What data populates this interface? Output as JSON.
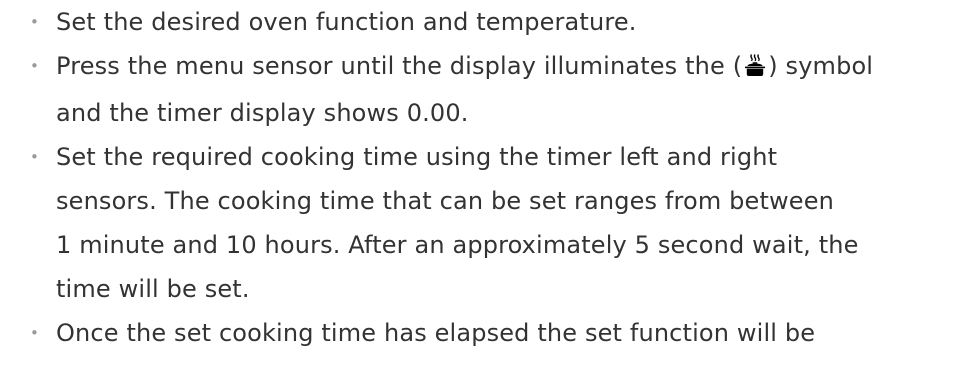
{
  "bullet_glyph": "•",
  "steps": [
    {
      "lines": [
        "Set the desired oven function and temperature."
      ]
    },
    {
      "line1_before": "Press the menu sensor until the display illuminates the (",
      "line1_after": ") symbol",
      "symbol_icon": "pot-steam-icon",
      "line2": "and the timer display shows 0.00."
    },
    {
      "lines": [
        "Set the required cooking time using the timer left and right",
        "sensors. The cooking time that can be set ranges from between",
        "1 minute and 10 hours. After an approximately 5 second wait, the",
        "time will be set."
      ]
    },
    {
      "lines": [
        "Once the set cooking time has elapsed the set function will be"
      ]
    }
  ]
}
